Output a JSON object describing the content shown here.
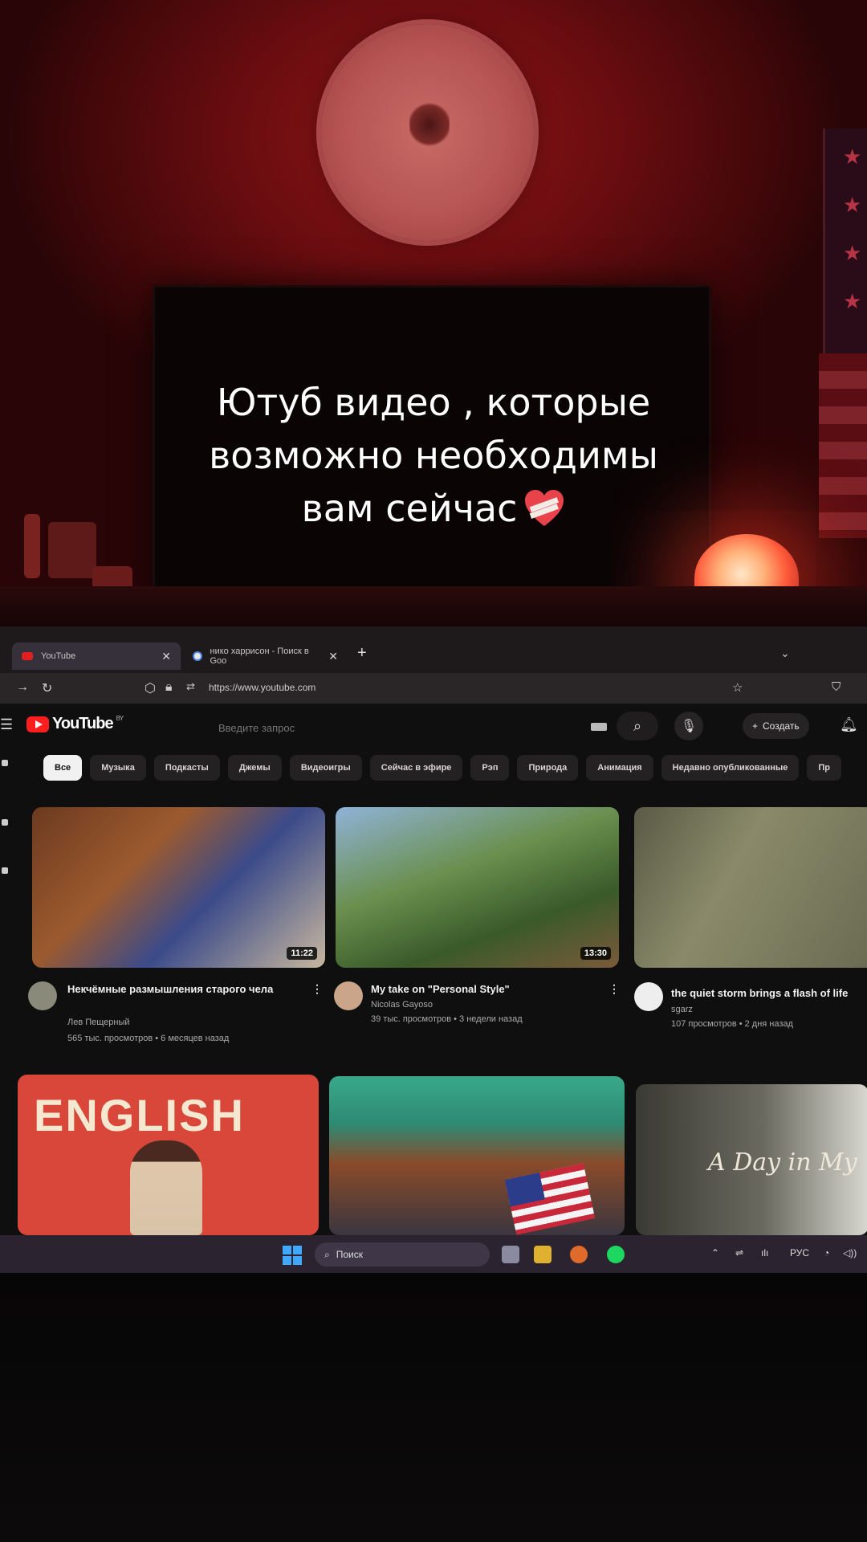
{
  "caption": {
    "line1": "Ютуб видео , которые",
    "line2": "возможно необходимы",
    "line3": "вам сейчас"
  },
  "browser": {
    "tabs": [
      {
        "label": "YouTube",
        "active": true
      },
      {
        "label": "нико харрисон - Поиск в Goo",
        "active": false
      }
    ],
    "url": "https://www.youtube.com"
  },
  "youtube": {
    "logo_text": "YouTube",
    "region": "BY",
    "search_placeholder": "Введите запрос",
    "create_label": "Создать",
    "chips": [
      "Все",
      "Музыка",
      "Подкасты",
      "Джемы",
      "Видеоигры",
      "Сейчас в эфире",
      "Рэп",
      "Природа",
      "Анимация",
      "Недавно опубликованные",
      "Пр"
    ],
    "videos": [
      {
        "title": "Некчёмные размышления старого чела",
        "channel": "Лев Пещерный",
        "meta": "565 тыс. просмотров • 6 месяцев назад",
        "duration": "11:22"
      },
      {
        "title": "My take on \"Personal Style\"",
        "channel": "Nicolas Gayoso",
        "meta": "39 тыс. просмотров • 3 недели назад",
        "duration": "13:30"
      },
      {
        "title": "the quiet storm brings a flash of life",
        "channel": "sgarz",
        "meta": "107 просмотров • 2 дня назад",
        "duration": ""
      }
    ],
    "row2": [
      {
        "thumb_text": "ENGLISH"
      },
      {
        "thumb_text": ""
      },
      {
        "thumb_text": "A Day in My"
      }
    ]
  },
  "taskbar": {
    "search_label": "Поиск",
    "lang": "РУС"
  },
  "colors": {
    "youtube_red": "#ff1e1e",
    "room_red": "#8e1518"
  }
}
